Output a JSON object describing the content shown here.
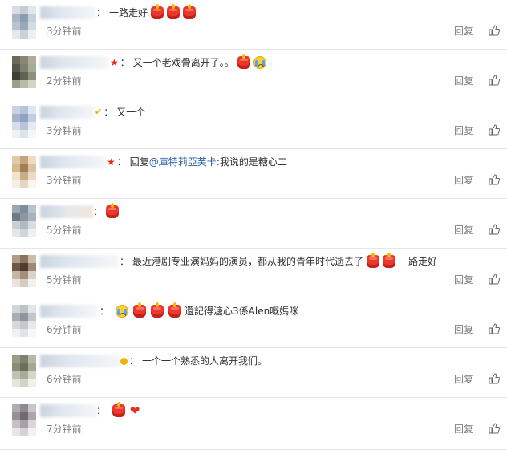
{
  "comments": [
    {
      "time": "3分钟前",
      "reply": "回复",
      "text_parts": [
        "一路走好"
      ],
      "emojis": [
        "candle",
        "candle",
        "candle"
      ],
      "star": false
    },
    {
      "time": "2分钟前",
      "reply": "回复",
      "text_parts": [
        "又一个老戏骨离开了。。"
      ],
      "emojis": [
        "candle",
        "cry"
      ],
      "star": true
    },
    {
      "time": "3分钟前",
      "reply": "回复",
      "text_parts": [
        "又一个"
      ],
      "emojis": [],
      "star": false
    },
    {
      "time": "3分钟前",
      "reply": "回复",
      "reply_prefix": "回复",
      "mention": "@庫特莉亞芙卡",
      "text_parts": [
        ":我说的是糖心二"
      ],
      "emojis": [],
      "star": true
    },
    {
      "time": "5分钟前",
      "reply": "回复",
      "text_parts": [
        ""
      ],
      "emojis": [
        "candle"
      ],
      "star": false
    },
    {
      "time": "5分钟前",
      "reply": "回复",
      "text_parts": [
        "最近港剧专业演妈妈的演员，都从我的青年时代逝去了"
      ],
      "emojis_after": [
        "candle",
        "candle"
      ],
      "tail": "一路走好",
      "star": false
    },
    {
      "time": "6分钟前",
      "reply": "回复",
      "text_parts": [
        ""
      ],
      "emojis": [
        "cry",
        "candle",
        "candle",
        "candle"
      ],
      "tail": "還記得溏心3係Alen嘅媽咪",
      "star": false
    },
    {
      "time": "6分钟前",
      "reply": "回复",
      "text_parts": [
        "一个一个熟悉的人离开我们。"
      ],
      "emojis": [],
      "star": false
    },
    {
      "time": "7分钟前",
      "reply": "回复",
      "text_parts": [
        ""
      ],
      "emojis": [
        "candle",
        "heart"
      ],
      "star": false
    }
  ],
  "colon": "："
}
